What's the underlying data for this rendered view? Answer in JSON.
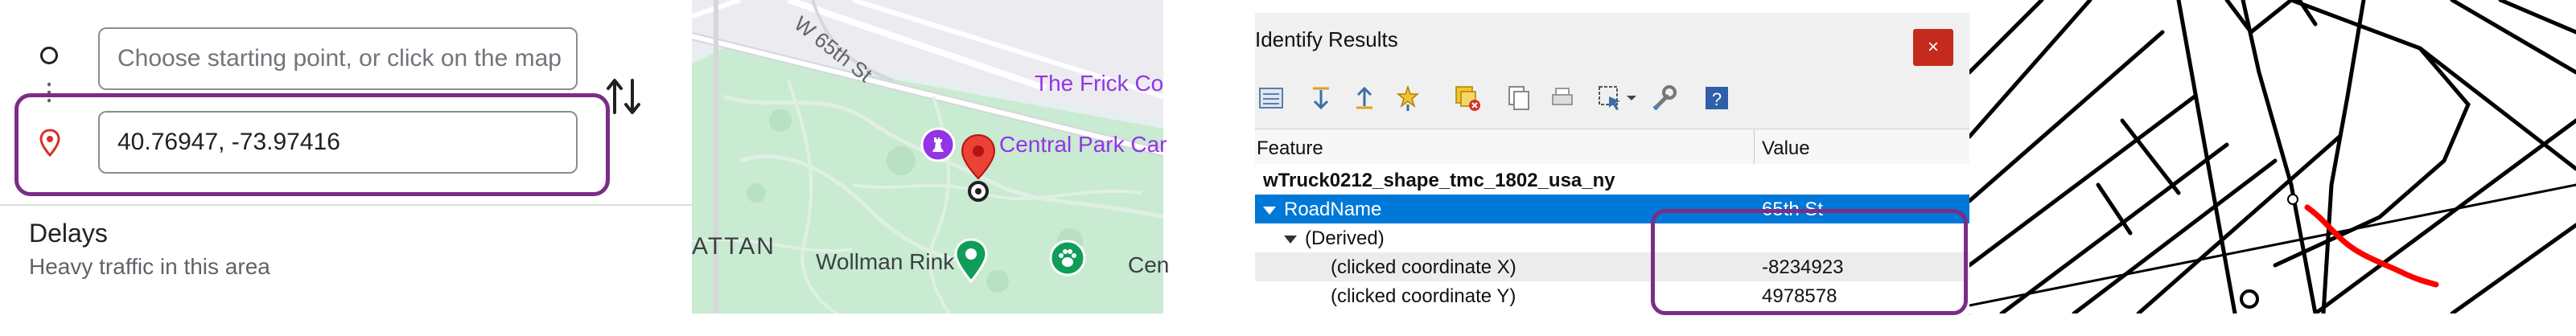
{
  "directions": {
    "start_placeholder": "Choose starting point, or click on the map",
    "destination_value": "40.76947, -73.97416",
    "delays_title": "Delays",
    "delays_subtitle": "Heavy traffic in this area"
  },
  "map": {
    "labels": {
      "street": "W 65th St",
      "frick": "The Frick Co",
      "central_park": "Central Park Car",
      "district": "ATTAN",
      "rink": "Wollman Rink",
      "cen": "Cen"
    }
  },
  "identify": {
    "title": "Identify Results",
    "close_label": "×",
    "columns": {
      "feature": "Feature",
      "value": "Value"
    },
    "layer_name": "wTruck0212_shape_tmc_1802_usa_ny",
    "rows": [
      {
        "feature": "RoadName",
        "value": "65th St"
      },
      {
        "feature": "(Derived)",
        "value": ""
      },
      {
        "feature": "(clicked coordinate X)",
        "value": "-8234923"
      },
      {
        "feature": "(clicked coordinate Y)",
        "value": "4978578"
      }
    ]
  },
  "colors": {
    "highlight": "#7b2d86",
    "selection": "#0078d7",
    "map_pin": "#ea4335",
    "park_green": "#c8ebd2",
    "route": "#ff0000"
  }
}
